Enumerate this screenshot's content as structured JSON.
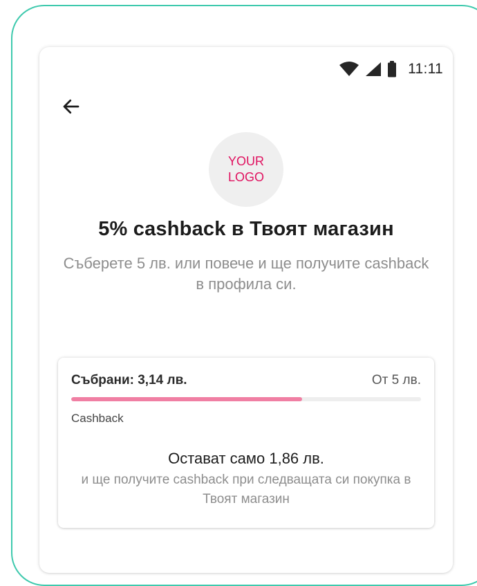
{
  "status_bar": {
    "time": "11:11",
    "icons": [
      "wifi-icon",
      "signal-icon",
      "battery-icon"
    ]
  },
  "header": {
    "back_icon": "arrow-left-icon"
  },
  "logo": {
    "line1": "YOUR",
    "line2": "LOGO"
  },
  "offer": {
    "title": "5% cashback в Твоят магазин",
    "subtitle": "Съберете 5 лв. или повече и ще получите cashback в профила си."
  },
  "progress_card": {
    "collected": "Събрани: 3,14 лв.",
    "target": "От 5 лв.",
    "progress_fraction": 0.66,
    "label": "Cashback",
    "remaining": "Остават само 1,86 лв.",
    "remaining_note": "и ще получите cashback при следващата си покупка в Твоят магазин"
  },
  "colors": {
    "device_border": "#3ec9ad",
    "logo_text": "#e0115f",
    "progress_fill": "#f07fa3",
    "progress_track": "#eeeeee"
  }
}
